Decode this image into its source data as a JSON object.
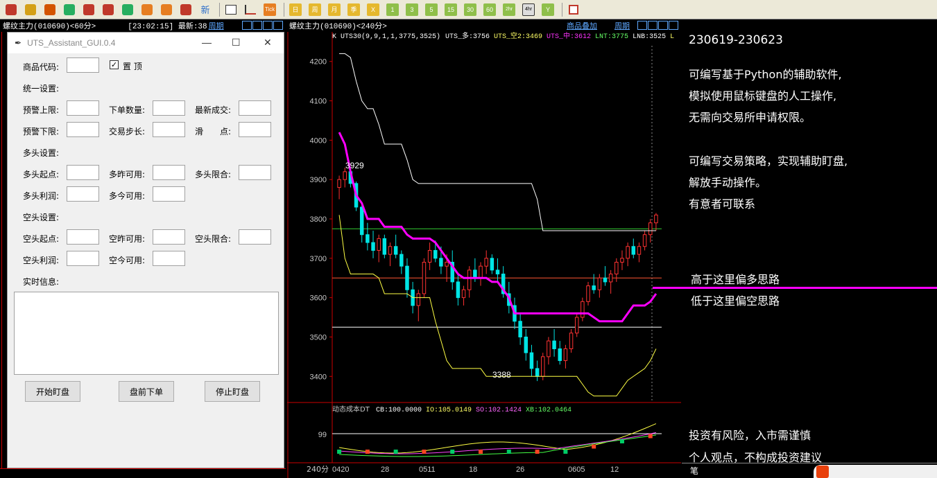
{
  "toolbar": {
    "items": [
      {
        "name": "home-icon",
        "color": "#c0392b"
      },
      {
        "name": "database-icon",
        "color": "#d4a017"
      },
      {
        "name": "f10-icon",
        "color": "#d35400"
      },
      {
        "name": "refresh-icon",
        "color": "#27ae60"
      },
      {
        "name": "zoom-in-icon",
        "color": "#c0392b"
      },
      {
        "name": "zoom-out-icon",
        "color": "#c0392b"
      },
      {
        "name": "window-icon",
        "color": "#27ae60"
      },
      {
        "name": "pencil-icon",
        "color": "#e67e22"
      },
      {
        "name": "shape-icon",
        "color": "#e67e22"
      },
      {
        "name": "filter-icon",
        "color": "#c0392b"
      }
    ],
    "new_label": "新",
    "tick_label": "Tick",
    "periods": [
      "日",
      "周",
      "月",
      "季",
      "X",
      "1",
      "3",
      "5",
      "15",
      "30",
      "60",
      "2hr",
      "4hr",
      "Y"
    ],
    "active_period": "4hr"
  },
  "left_chart": {
    "symbol": "螺纹主力(010690)<60分>",
    "time": "[23:02:15] 最新:38",
    "period_link": "周期"
  },
  "dialog": {
    "title": "UTS_Assistant_GUI.0.4",
    "product_code_label": "商品代码:",
    "pin_label": "置 顶",
    "pin_checked": "✓",
    "unified_settings": "统一设置:",
    "alert_upper": "预警上限:",
    "order_qty": "下单数量:",
    "last_trade": "最新成交:",
    "alert_lower": "预警下限:",
    "trade_step": "交易步长:",
    "slippage": "滑　　点:",
    "long_settings": "多头设置:",
    "long_start": "多头起点:",
    "long_yest_avail": "多昨可用:",
    "long_limit": "多头限合:",
    "long_profit": "多头利润:",
    "long_today_avail": "多今可用:",
    "short_settings": "空头设置:",
    "short_start": "空头起点:",
    "short_yest_avail": "空昨可用:",
    "short_limit": "空头限合:",
    "short_profit": "空头利润:",
    "short_today_avail": "空今可用:",
    "realtime_info": "实时信息:",
    "start_button": "开始盯盘",
    "preopen_button": "盘前下单",
    "stop_button": "停止盯盘"
  },
  "main_chart": {
    "symbol": "螺纹主力(010690)<240分>",
    "overlay_link": "商品叠加",
    "period_link": "周期",
    "indicator_line": {
      "prefix": "K",
      "name": "UTS30(9,9,1,1,3775,3525)",
      "items": [
        {
          "text": "UTS_多:3756",
          "color": "#ffffff"
        },
        {
          "text": "UTS_空2:3469",
          "color": "#ffff66"
        },
        {
          "text": "UTS_中:3612",
          "color": "#ff33ff"
        },
        {
          "text": "LNT:3775",
          "color": "#66ff66"
        },
        {
          "text": "LNB:3525",
          "color": "#ffffff"
        },
        {
          "text": "L",
          "color": "#ffff66"
        }
      ]
    },
    "y_ticks": [
      "4200",
      "4100",
      "4000",
      "3900",
      "3800",
      "3700",
      "3600",
      "3500",
      "3400"
    ],
    "annotation_high": "3929",
    "annotation_low": "3388",
    "sub_indicator": {
      "name": "动态成本DT",
      "items": [
        {
          "text": "CB:100.0000",
          "color": "#ffffff"
        },
        {
          "text": "IO:105.0149",
          "color": "#ffff66"
        },
        {
          "text": "SO:102.1424",
          "color": "#ff66ff"
        },
        {
          "text": "XB:102.0464",
          "color": "#66ff66"
        }
      ],
      "y_tick": "99"
    },
    "x_axis": {
      "period": "240分",
      "labels": [
        "0420",
        "28",
        "0511",
        "18",
        "26",
        "0605",
        "12"
      ]
    }
  },
  "commentary": {
    "date_range": "230619-230623",
    "para1": [
      "可编写基于Python的辅助软件,",
      "模拟使用鼠标键盘的人工操作,",
      "无需向交易所申请权限。"
    ],
    "para2": [
      "可编写交易策略，实现辅助盯盘,",
      "解放手动操作。",
      "有意者可联系"
    ],
    "above_line": "高于这里偏多思路",
    "below_line": "低于这里偏空思路",
    "risk": "投资有风险，入市需谨慎",
    "disclaimer": "个人观点，不构成投资建议",
    "footer": "笔"
  },
  "chart_data": {
    "type": "candlestick",
    "ylim": [
      3360,
      4240
    ],
    "candles": [
      [
        3880,
        3910,
        3850,
        3900
      ],
      [
        3900,
        3930,
        3880,
        3920
      ],
      [
        3920,
        3929,
        3880,
        3890
      ],
      [
        3890,
        3895,
        3820,
        3830
      ],
      [
        3830,
        3840,
        3740,
        3760
      ],
      [
        3760,
        3790,
        3720,
        3740
      ],
      [
        3740,
        3770,
        3700,
        3720
      ],
      [
        3720,
        3760,
        3690,
        3750
      ],
      [
        3750,
        3760,
        3700,
        3710
      ],
      [
        3710,
        3740,
        3680,
        3730
      ],
      [
        3730,
        3760,
        3700,
        3710
      ],
      [
        3710,
        3720,
        3660,
        3680
      ],
      [
        3680,
        3700,
        3600,
        3620
      ],
      [
        3620,
        3640,
        3560,
        3580
      ],
      [
        3580,
        3620,
        3540,
        3610
      ],
      [
        3610,
        3700,
        3600,
        3690
      ],
      [
        3690,
        3740,
        3670,
        3720
      ],
      [
        3720,
        3745,
        3690,
        3700
      ],
      [
        3700,
        3730,
        3660,
        3680
      ],
      [
        3680,
        3710,
        3640,
        3690
      ],
      [
        3690,
        3720,
        3620,
        3640
      ],
      [
        3640,
        3660,
        3580,
        3600
      ],
      [
        3600,
        3630,
        3580,
        3620
      ],
      [
        3620,
        3680,
        3600,
        3670
      ],
      [
        3670,
        3700,
        3640,
        3650
      ],
      [
        3650,
        3690,
        3630,
        3680
      ],
      [
        3680,
        3720,
        3660,
        3700
      ],
      [
        3700,
        3710,
        3660,
        3670
      ],
      [
        3670,
        3700,
        3640,
        3660
      ],
      [
        3660,
        3680,
        3600,
        3610
      ],
      [
        3610,
        3640,
        3560,
        3580
      ],
      [
        3580,
        3600,
        3520,
        3540
      ],
      [
        3540,
        3560,
        3480,
        3500
      ],
      [
        3500,
        3520,
        3440,
        3460
      ],
      [
        3460,
        3480,
        3400,
        3420
      ],
      [
        3420,
        3440,
        3388,
        3400
      ],
      [
        3400,
        3460,
        3390,
        3450
      ],
      [
        3450,
        3500,
        3430,
        3490
      ],
      [
        3490,
        3520,
        3450,
        3470
      ],
      [
        3470,
        3490,
        3430,
        3440
      ],
      [
        3440,
        3480,
        3420,
        3470
      ],
      [
        3470,
        3520,
        3460,
        3510
      ],
      [
        3510,
        3560,
        3500,
        3550
      ],
      [
        3550,
        3600,
        3540,
        3590
      ],
      [
        3590,
        3640,
        3580,
        3630
      ],
      [
        3630,
        3660,
        3610,
        3620
      ],
      [
        3620,
        3660,
        3600,
        3650
      ],
      [
        3650,
        3680,
        3630,
        3640
      ],
      [
        3640,
        3670,
        3610,
        3660
      ],
      [
        3660,
        3700,
        3640,
        3690
      ],
      [
        3690,
        3720,
        3670,
        3700
      ],
      [
        3700,
        3740,
        3680,
        3730
      ],
      [
        3730,
        3750,
        3700,
        3710
      ],
      [
        3710,
        3740,
        3690,
        3730
      ],
      [
        3730,
        3770,
        3720,
        3760
      ],
      [
        3760,
        3800,
        3740,
        3790
      ],
      [
        3790,
        3815,
        3770,
        3810
      ]
    ],
    "lines": {
      "uts_long": [
        4220,
        4220,
        4210,
        4150,
        4100,
        4080,
        4080,
        4040,
        3990,
        3990,
        3990,
        3990,
        3950,
        3900,
        3890,
        3890,
        3890,
        3890,
        3890,
        3890,
        3890,
        3890,
        3890,
        3890,
        3890,
        3890,
        3890,
        3890,
        3890,
        3890,
        3890,
        3890,
        3890,
        3890,
        3890,
        3850,
        3770,
        3770,
        3770,
        3770,
        3770,
        3770,
        3770,
        3770,
        3770,
        3770,
        3770,
        3770,
        3770,
        3770,
        3770,
        3770,
        3770,
        3770,
        3770,
        3770,
        3770
      ],
      "uts_mid": [
        4020,
        3990,
        3920,
        3860,
        3840,
        3800,
        3800,
        3800,
        3780,
        3780,
        3780,
        3780,
        3760,
        3750,
        3750,
        3750,
        3750,
        3740,
        3720,
        3700,
        3680,
        3660,
        3650,
        3650,
        3650,
        3650,
        3650,
        3640,
        3640,
        3620,
        3600,
        3560,
        3560,
        3560,
        3560,
        3560,
        3560,
        3560,
        3560,
        3560,
        3560,
        3560,
        3560,
        3560,
        3560,
        3550,
        3540,
        3540,
        3540,
        3540,
        3540,
        3560,
        3580,
        3580,
        3580,
        3590,
        3610
      ],
      "uts_short": [
        3810,
        3700,
        3660,
        3660,
        3660,
        3660,
        3660,
        3650,
        3610,
        3610,
        3610,
        3610,
        3610,
        3600,
        3600,
        3600,
        3600,
        3540,
        3490,
        3440,
        3420,
        3420,
        3420,
        3420,
        3420,
        3420,
        3400,
        3400,
        3400,
        3400,
        3400,
        3400,
        3400,
        3400,
        3400,
        3400,
        3400,
        3400,
        3400,
        3400,
        3400,
        3400,
        3400,
        3380,
        3360,
        3350,
        3350,
        3350,
        3350,
        3350,
        3370,
        3390,
        3400,
        3410,
        3420,
        3440,
        3470
      ],
      "lnt": 3775,
      "lnb": 3525,
      "mid_ref": 3650
    }
  }
}
